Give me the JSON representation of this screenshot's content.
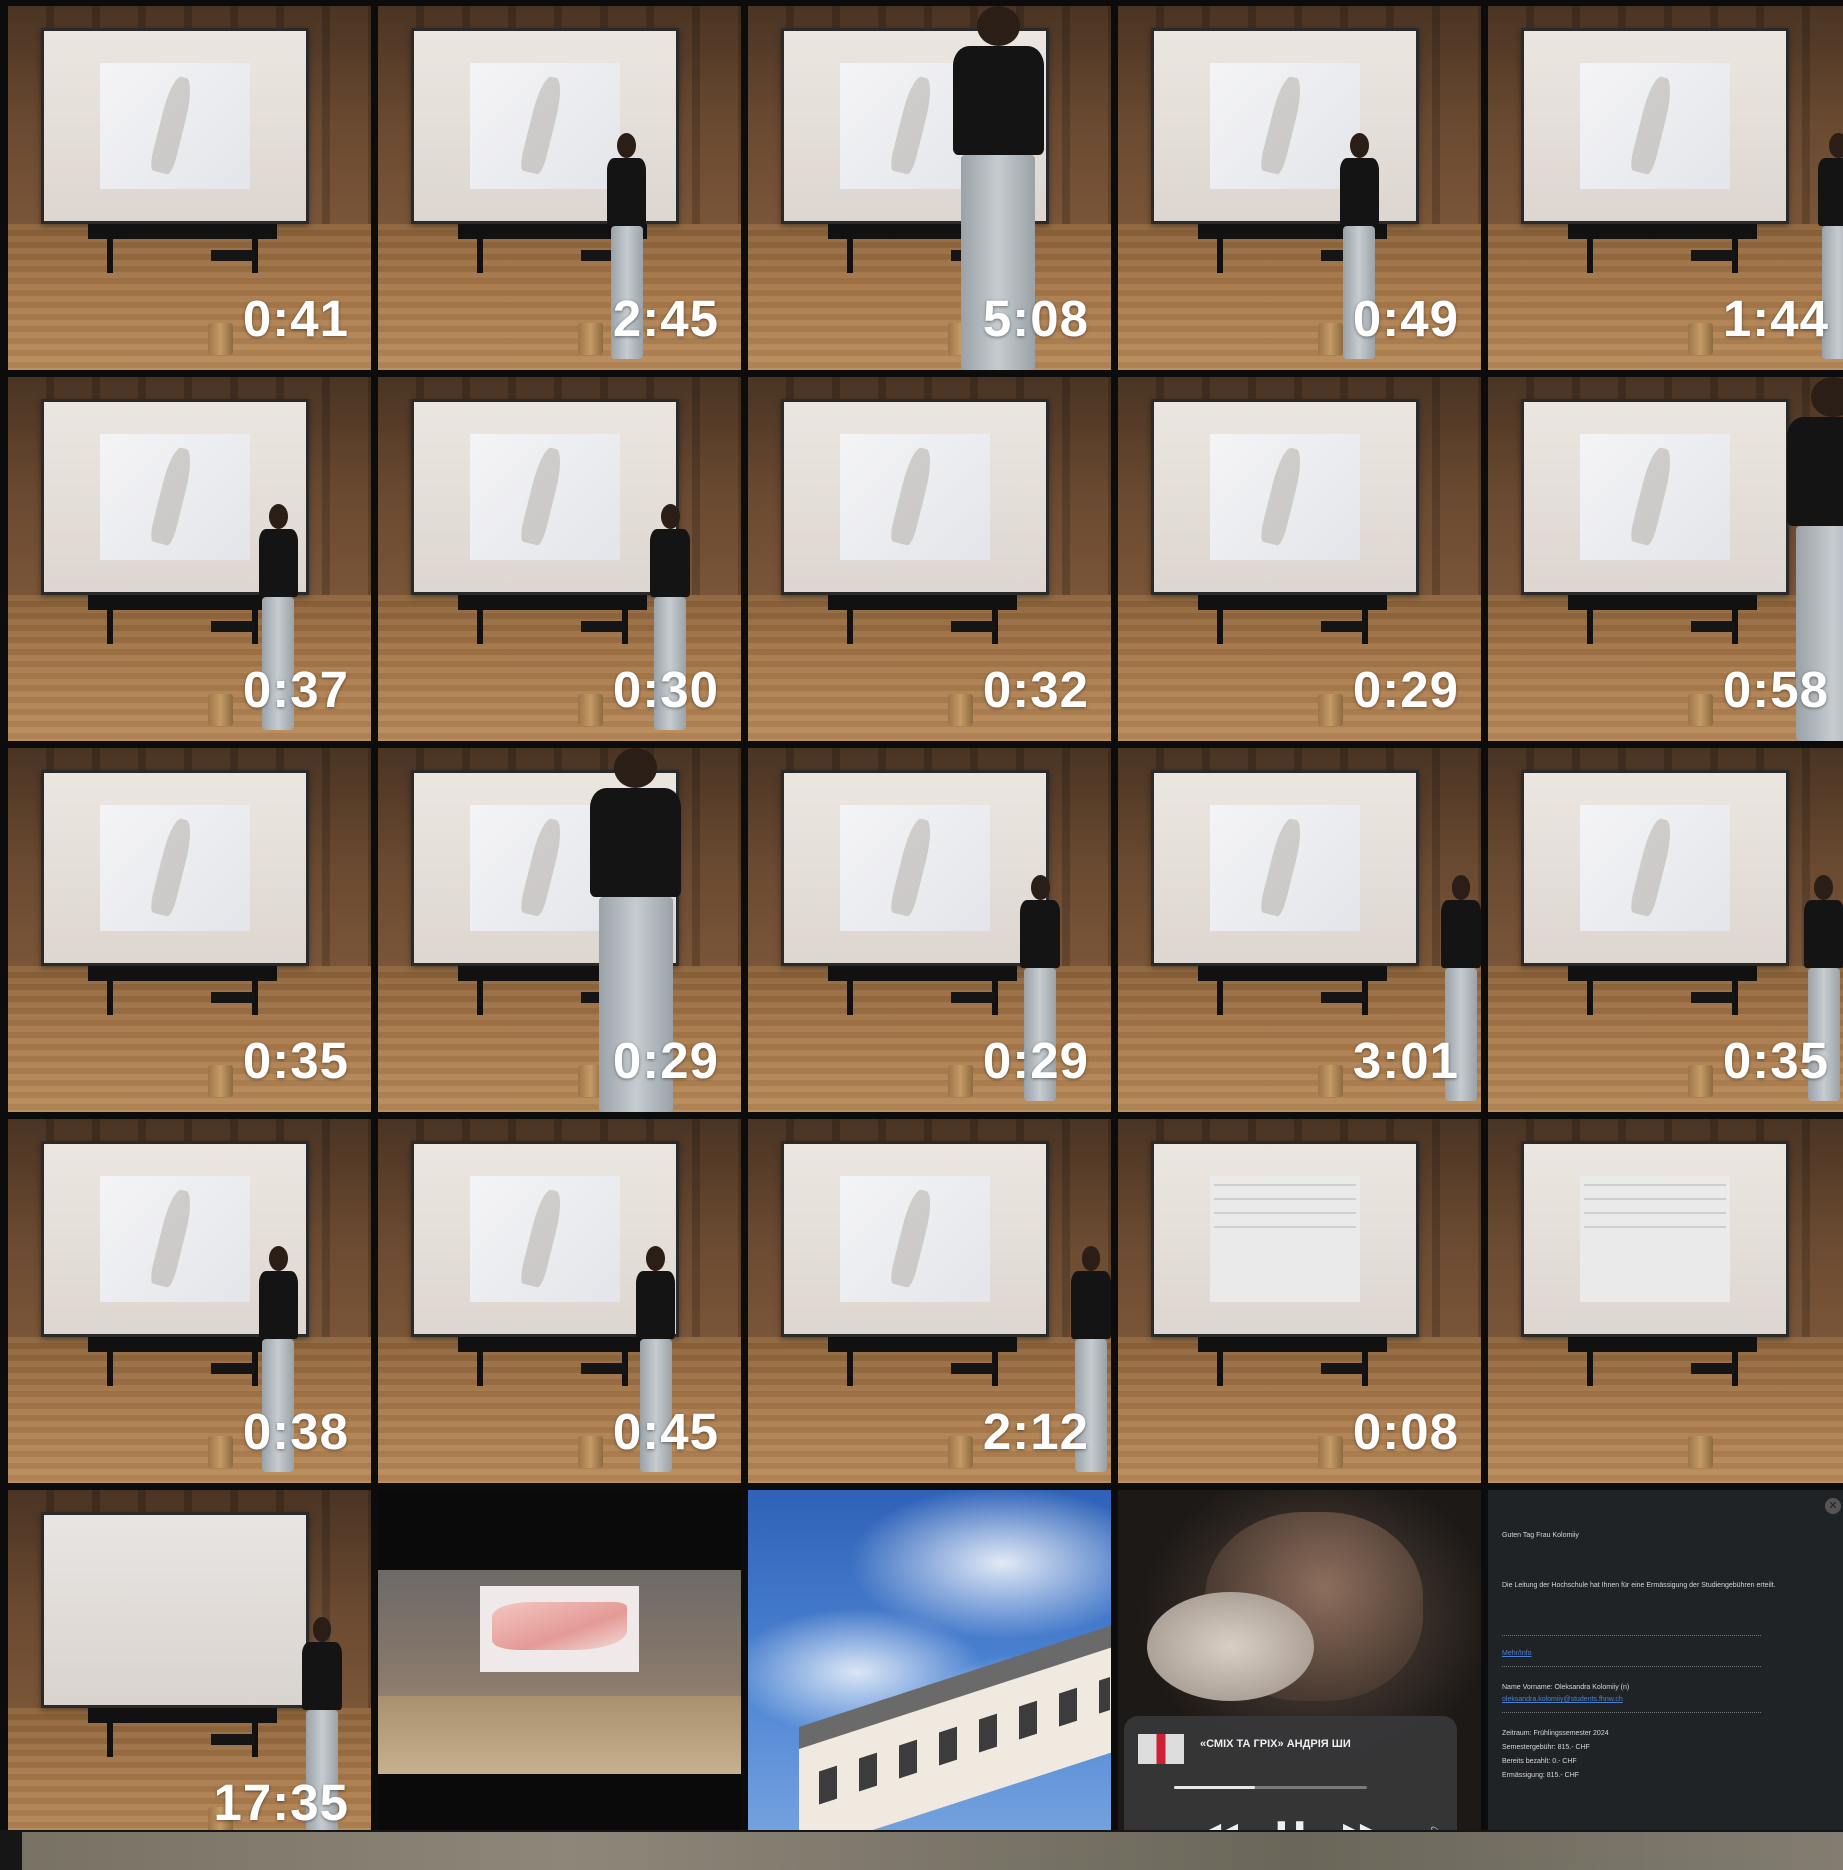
{
  "gallery": {
    "videos": [
      {
        "duration": "0:41",
        "variant": "stage"
      },
      {
        "duration": "2:45",
        "variant": "stage"
      },
      {
        "duration": "5:08",
        "variant": "stage"
      },
      {
        "duration": "0:49",
        "variant": "stage"
      },
      {
        "duration": "1:44",
        "variant": "stage"
      },
      {
        "duration": "0:37",
        "variant": "stage"
      },
      {
        "duration": "0:30",
        "variant": "stage"
      },
      {
        "duration": "0:32",
        "variant": "stage"
      },
      {
        "duration": "0:29",
        "variant": "stage"
      },
      {
        "duration": "0:58",
        "variant": "stage"
      },
      {
        "duration": "0:35",
        "variant": "stage"
      },
      {
        "duration": "0:29",
        "variant": "stage"
      },
      {
        "duration": "0:29",
        "variant": "stage"
      },
      {
        "duration": "3:01",
        "variant": "stage"
      },
      {
        "duration": "0:35",
        "variant": "stage"
      },
      {
        "duration": "0:38",
        "variant": "stage"
      },
      {
        "duration": "0:45",
        "variant": "stage"
      },
      {
        "duration": "2:12",
        "variant": "stage"
      },
      {
        "duration": "0:08",
        "variant": "daw"
      },
      {
        "duration": "",
        "variant": "daw"
      },
      {
        "duration": "17:35",
        "variant": "blank"
      }
    ],
    "now_playing": {
      "track_title": "«СМІХ ТА ГРІХ» АНДРІЯ ШИ",
      "progress": 0.42,
      "icons": [
        "rewind-icon",
        "pause-icon",
        "fast-forward-icon",
        "volume-icon"
      ]
    },
    "email": {
      "subject": "Guten Tag Frau Kolomiiy",
      "body": "Die Leitung der Hochschule hat Ihnen für eine Ermässigung der Studiengebühren erteilt.",
      "link": "Mehr/Info",
      "name_line": "Name Vorname: Oleksandra Kolomiiy (n)",
      "email_link": "oleksandra.kolomiiy@students.fhnw.ch",
      "period": "Zeitraum: Frühlingssemester 2024",
      "fee": "Semestergebühr: 815.- CHF",
      "paid": "Bereits bezahlt: 0.- CHF",
      "reduction": "Ermässigung: 815.- CHF"
    }
  }
}
